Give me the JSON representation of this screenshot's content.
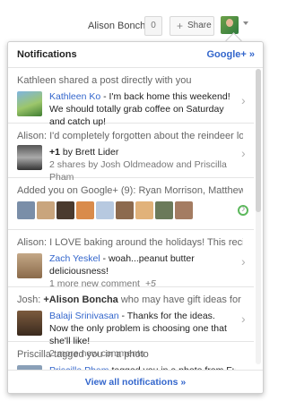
{
  "topbar": {
    "user_name": "Alison Boncha",
    "count": "0",
    "share_label": "Share",
    "share_plus": "+"
  },
  "panel": {
    "title": "Notifications",
    "gplus_link": "Google+ »",
    "view_all": "View all notifications »"
  },
  "notifications": [
    {
      "headline": "Kathleen shared a post directly with you",
      "author": "Kathleen Ko",
      "text": " - I'm back home this weekend! We should totally grab coffee on Saturday and catch up!"
    },
    {
      "headline": "Alison: I'd completely forgotten about the reindeer love...",
      "line1_prefix": "+1",
      "line1_rest": " by Brett Lider",
      "line2": "2 shares by Josh Oldmeadow and Priscilla Pham"
    },
    {
      "headline": "Added you on Google+ (9): Ryan Morrison, Matthew..."
    },
    {
      "headline": "Alison: I LOVE baking around the holidays! This recipe is...",
      "author": "Zach Yeskel",
      "text": " - woah...peanut butter deliciousness!",
      "meta": "1 more new comment",
      "meta2": "+5"
    },
    {
      "headline_prefix": "Josh: ",
      "headline_bold": "+Alison Boncha",
      "headline_rest": " who may have gift ideas for your...",
      "author": "Balaji Srinivasan",
      "text": " - Thanks for the ideas. Now the only problem is choosing one that she'll like!",
      "meta": "2 more new comments"
    },
    {
      "headline": "Priscilla tagged you in a photo",
      "author": "Priscilla Pham",
      "text": " tagged you in a photo from Fun in the sun"
    }
  ],
  "colors": {
    "link": "#3366cc",
    "circle_ring": "#5cb85c"
  }
}
